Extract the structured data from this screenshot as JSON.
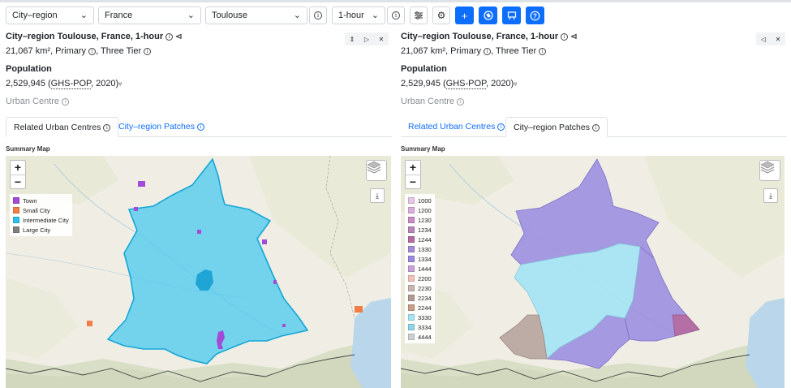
{
  "toolbar": {
    "type_select": "City–region",
    "country_select": "France",
    "city_select": "Toulouse",
    "travel_select": "1-hour",
    "colors": {
      "primary": "#0d6efd"
    }
  },
  "left": {
    "title": "City–region Toulouse, France, 1-hour",
    "subtitle_area": "21,067 km², Primary",
    "subtitle_tier": "Three Tier",
    "population_label": "Population",
    "population_value": "2,529,945 (",
    "population_source": "GHS-POP",
    "population_year": ", 2020)",
    "urban_centre": "Urban Centre",
    "tabs": [
      {
        "label": "Related Urban Centres",
        "active": true
      },
      {
        "label": "City–region Patches",
        "active": false
      }
    ],
    "summary_map_label": "Summary Map",
    "legend": [
      {
        "label": "Town",
        "color": "#a34bd6"
      },
      {
        "label": "Small City",
        "color": "#f07e45"
      },
      {
        "label": "Intermediate City",
        "color": "#2cc1ec"
      },
      {
        "label": "Large City",
        "color": "#808080"
      }
    ]
  },
  "right": {
    "title": "City–region Toulouse, France, 1-hour",
    "subtitle_area": "21,067 km², Primary",
    "subtitle_tier": "Three Tier",
    "population_label": "Population",
    "population_value": "2,529,945 (",
    "population_source": "GHS-POP",
    "population_year": ", 2020)",
    "urban_centre": "Urban Centre",
    "tabs": [
      {
        "label": "Related Urban Centres",
        "active": false
      },
      {
        "label": "City–region Patches",
        "active": true
      }
    ],
    "summary_map_label": "Summary Map",
    "legend": [
      {
        "label": "1000",
        "color": "#e9c6e6"
      },
      {
        "label": "1200",
        "color": "#dcaedb"
      },
      {
        "label": "1230",
        "color": "#c98cc6"
      },
      {
        "label": "1234",
        "color": "#b886b8"
      },
      {
        "label": "1244",
        "color": "#b56aa0"
      },
      {
        "label": "1330",
        "color": "#a48ad8"
      },
      {
        "label": "1334",
        "color": "#9a8be0"
      },
      {
        "label": "1444",
        "color": "#c7a2dc"
      },
      {
        "label": "2200",
        "color": "#f0c2b4"
      },
      {
        "label": "2230",
        "color": "#c9b5b0"
      },
      {
        "label": "2234",
        "color": "#b39b93"
      },
      {
        "label": "2244",
        "color": "#c89d85"
      },
      {
        "label": "3330",
        "color": "#a7e3f2"
      },
      {
        "label": "3334",
        "color": "#8fd5e8"
      },
      {
        "label": "4444",
        "color": "#cfd0d2"
      }
    ]
  }
}
